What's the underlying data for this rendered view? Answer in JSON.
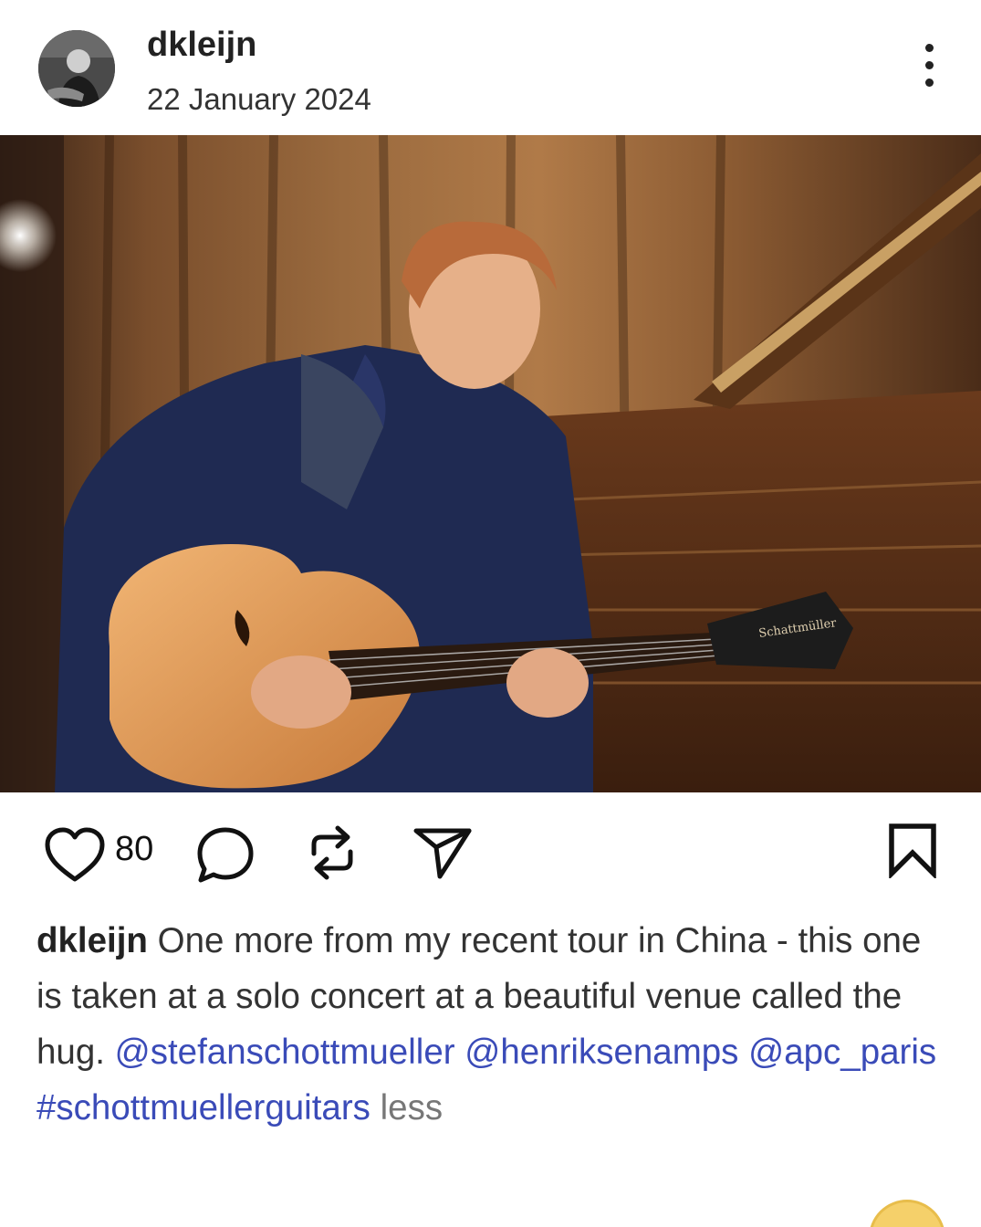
{
  "post": {
    "username": "dkleijn",
    "date": "22 January 2024",
    "like_count": "80",
    "caption": {
      "user": "dkleijn",
      "text": "One more from my recent tour in China - this one is taken at a solo concert at a beautiful venue called the hug.",
      "mentions": [
        "@stefanschottmueller",
        "@henriksenamps",
        "@apc_paris"
      ],
      "hashtag": "#schottmuellerguitars",
      "less_label": "less"
    },
    "photo": {
      "guitar_headstock_text": "Schattmüller"
    }
  },
  "icons": {
    "more": "more-vertical-icon",
    "like": "heart-icon",
    "comment": "comment-bubble-icon",
    "repost": "repost-icon",
    "share": "send-icon",
    "save": "bookmark-icon",
    "mention": "threads-at-icon"
  },
  "colors": {
    "mention": "#3a4bb8",
    "text": "#333333",
    "less": "#777777"
  }
}
